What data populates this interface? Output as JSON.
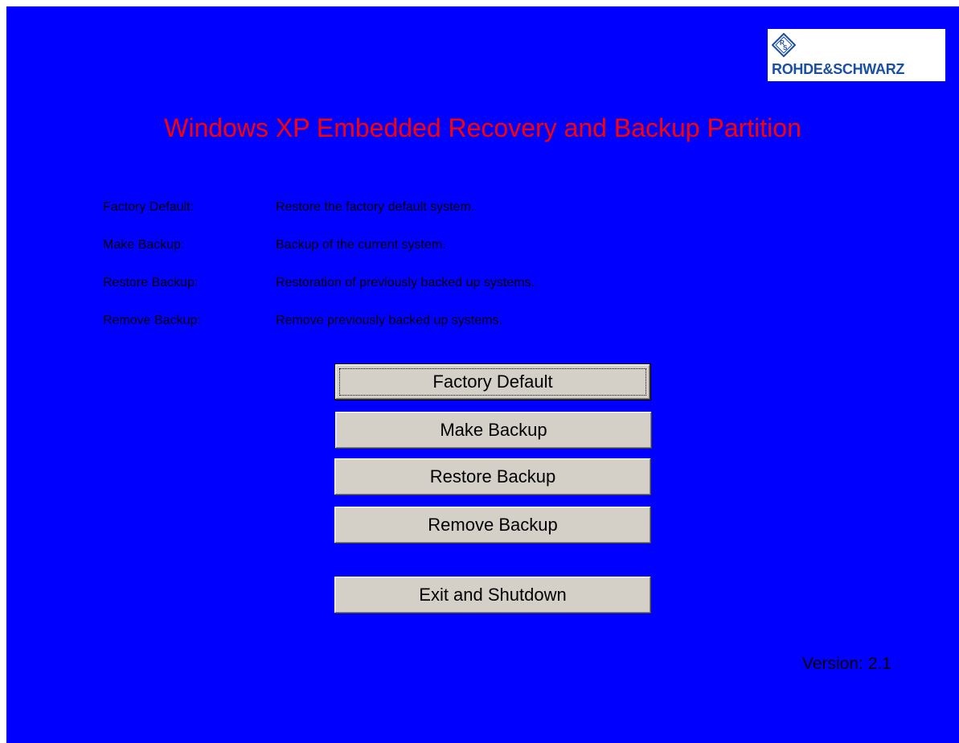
{
  "logo": {
    "text": "ROHDE&SCHWARZ",
    "emblem_icon": "rohde-schwarz-diamond-emblem"
  },
  "title": "Windows XP Embedded Recovery and Backup Partition",
  "descriptions": [
    {
      "label": "Factory Default:",
      "text": "Restore the factory default system."
    },
    {
      "label": "Make Backup:",
      "text": "Backup of the current system."
    },
    {
      "label": "Restore Backup:",
      "text": "Restoration of previously backed up systems."
    },
    {
      "label": "Remove Backup:",
      "text": "Remove previously backed up systems."
    }
  ],
  "buttons": {
    "factory_default": "Factory Default",
    "make_backup": "Make Backup",
    "restore_backup": "Restore Backup",
    "remove_backup": "Remove Backup",
    "exit_shutdown": "Exit and Shutdown"
  },
  "version": "Version: 2.1",
  "colors": {
    "background": "#0000ff",
    "title": "#ff0000",
    "button_face": "#d4d0c8",
    "text": "#000000",
    "logo_blue": "#1a4fa3"
  }
}
